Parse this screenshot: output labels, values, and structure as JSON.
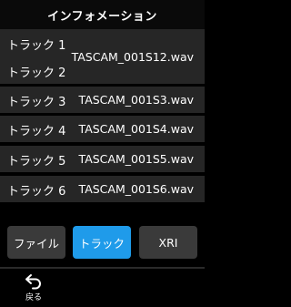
{
  "header": {
    "title": "インフォメーション"
  },
  "rows": [
    {
      "tracks": [
        "トラック 1",
        "トラック 2"
      ],
      "file": "TASCAM_001S12.wav"
    },
    {
      "tracks": [
        "トラック 3"
      ],
      "file": "TASCAM_001S3.wav"
    },
    {
      "tracks": [
        "トラック 4"
      ],
      "file": "TASCAM_001S4.wav"
    },
    {
      "tracks": [
        "トラック 5"
      ],
      "file": "TASCAM_001S5.wav"
    },
    {
      "tracks": [
        "トラック 6"
      ],
      "file": "TASCAM_001S6.wav"
    }
  ],
  "tabs": [
    {
      "label": "ファイル",
      "active": false
    },
    {
      "label": "トラック",
      "active": true
    },
    {
      "label": "XRI",
      "active": false
    }
  ],
  "footer": {
    "back_label": "戻る",
    "back_icon": "back-arrow-icon"
  },
  "colors": {
    "accent": "#1f9bea",
    "row_bg": "#262626",
    "tab_bg": "#3a3a3a",
    "background": "#000000"
  }
}
